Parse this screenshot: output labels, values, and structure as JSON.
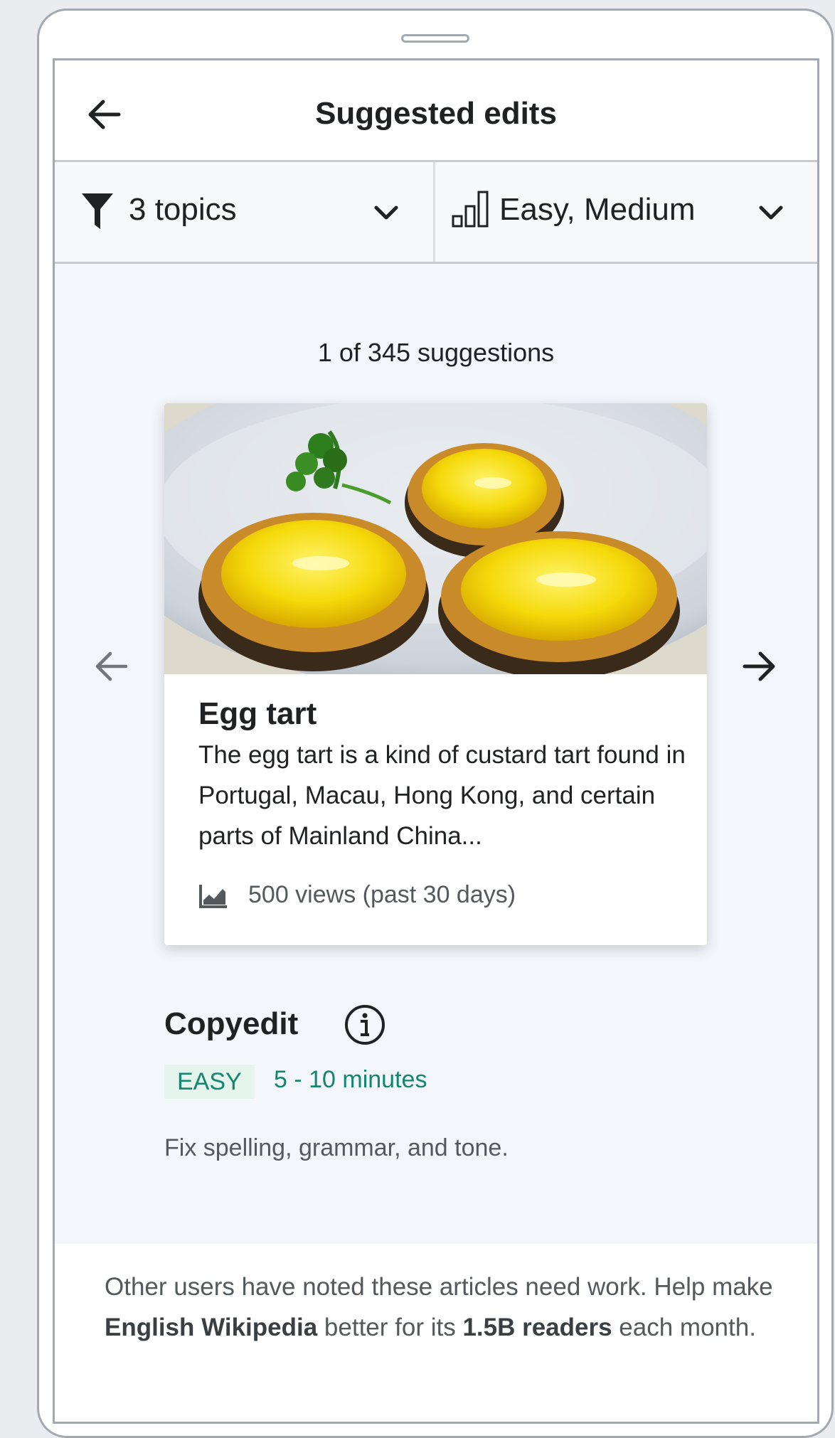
{
  "header": {
    "title": "Suggested edits",
    "back_icon": "arrow-left-icon"
  },
  "filters": {
    "topics_label": "3 topics",
    "topics_icon": "funnel-icon",
    "difficulty_label": "Easy, Medium",
    "difficulty_icon": "difficulty-bars-icon",
    "chevron_icon": "chevron-down-icon"
  },
  "suggestions": {
    "counter": "1 of 345 suggestions",
    "prev_icon": "arrow-left-icon",
    "next_icon": "arrow-right-icon"
  },
  "card": {
    "title": "Egg tart",
    "description": "The egg tart is a kind of custard tart found in Portugal, Macau, Hong Kong, and certain parts of Mainland China...",
    "views": "500 views (past 30 days)",
    "views_icon": "chart-area-icon"
  },
  "task": {
    "title": "Copyedit",
    "info_icon": "info-icon",
    "difficulty_badge": "EASY",
    "time_estimate": "5 - 10 minutes",
    "description": "Fix spelling, grammar, and tone."
  },
  "footer": {
    "text_before": "Other users have noted these articles need work. Help make ",
    "wiki_name": "English Wikipedia",
    "text_middle": " better for its ",
    "readers": "1.5B readers",
    "text_after": " each month."
  },
  "colors": {
    "accent_green": "#14866d",
    "badge_bg": "#e6f4ee",
    "page_bg": "#f3f7fc"
  }
}
